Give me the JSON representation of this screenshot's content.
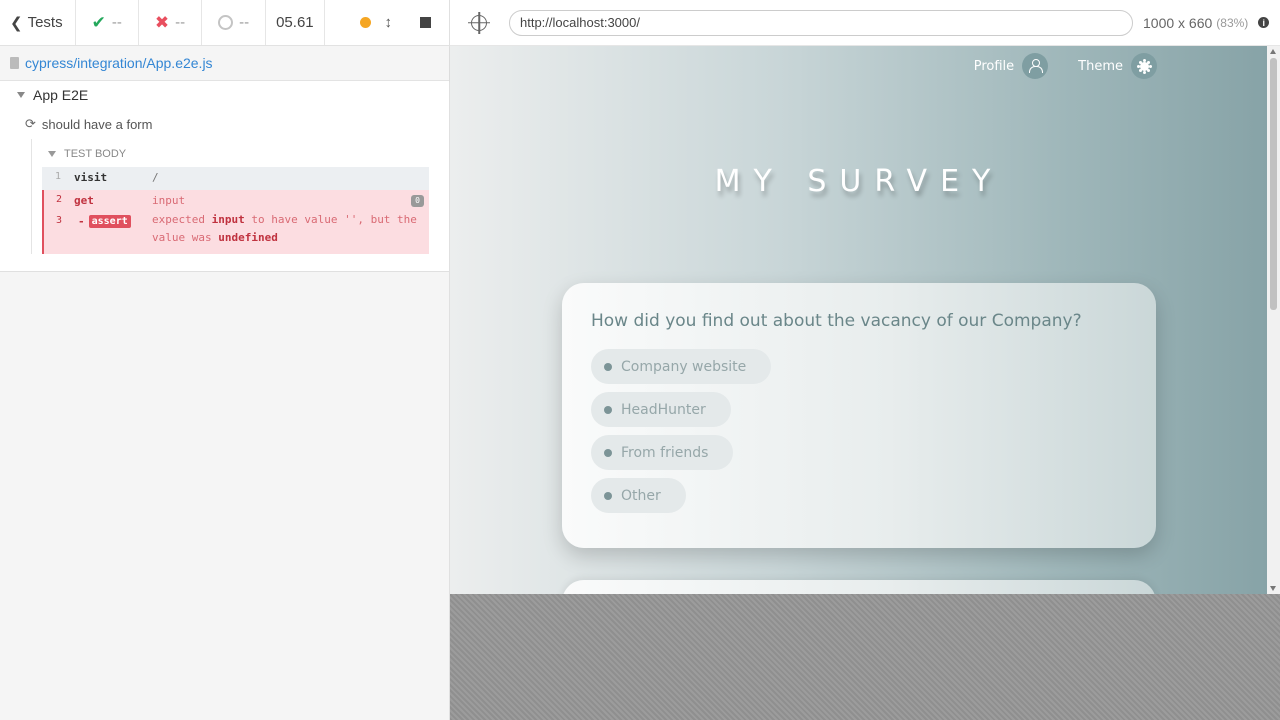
{
  "reporter": {
    "back_label": "Tests",
    "passed": "--",
    "failed": "--",
    "pending": "--",
    "duration": "05.61",
    "spec_path": "cypress/integration/App.e2e.js",
    "suite_title": "App E2E",
    "test_title": "should have a form",
    "test_body_label": "TEST BODY",
    "commands": [
      {
        "num": "1",
        "name": "visit",
        "message": "/"
      },
      {
        "num": "2",
        "name": "get",
        "message": "input",
        "badge": "0"
      },
      {
        "num": "3",
        "name": "assert",
        "msg_parts": [
          "expected",
          "input",
          "to have value '', but the value was",
          "undefined"
        ]
      }
    ]
  },
  "aut": {
    "url": "http://localhost:3000/",
    "viewport_size": "1000 x 660",
    "viewport_scale": "(83%)",
    "nav": {
      "profile": "Profile",
      "theme": "Theme"
    },
    "title": "MY SURVEY",
    "question": {
      "text": "How did you find out about the vacancy of our Company?",
      "options": [
        "Company website",
        "HeadHunter",
        "From friends",
        "Other"
      ]
    }
  },
  "colors": {
    "pass": "#24a85c",
    "fail": "#e94f5f",
    "link": "#3386d4",
    "running": "#f5a623",
    "app_accent": "#7f9ea2"
  },
  "icons": [
    "chevron-left-icon",
    "check-icon",
    "x-icon",
    "circle-icon",
    "dot-icon",
    "arrows-updown-icon",
    "stop-icon",
    "file-icon",
    "refresh-icon",
    "crosshair-icon",
    "info-icon",
    "user-icon",
    "sun-icon"
  ]
}
